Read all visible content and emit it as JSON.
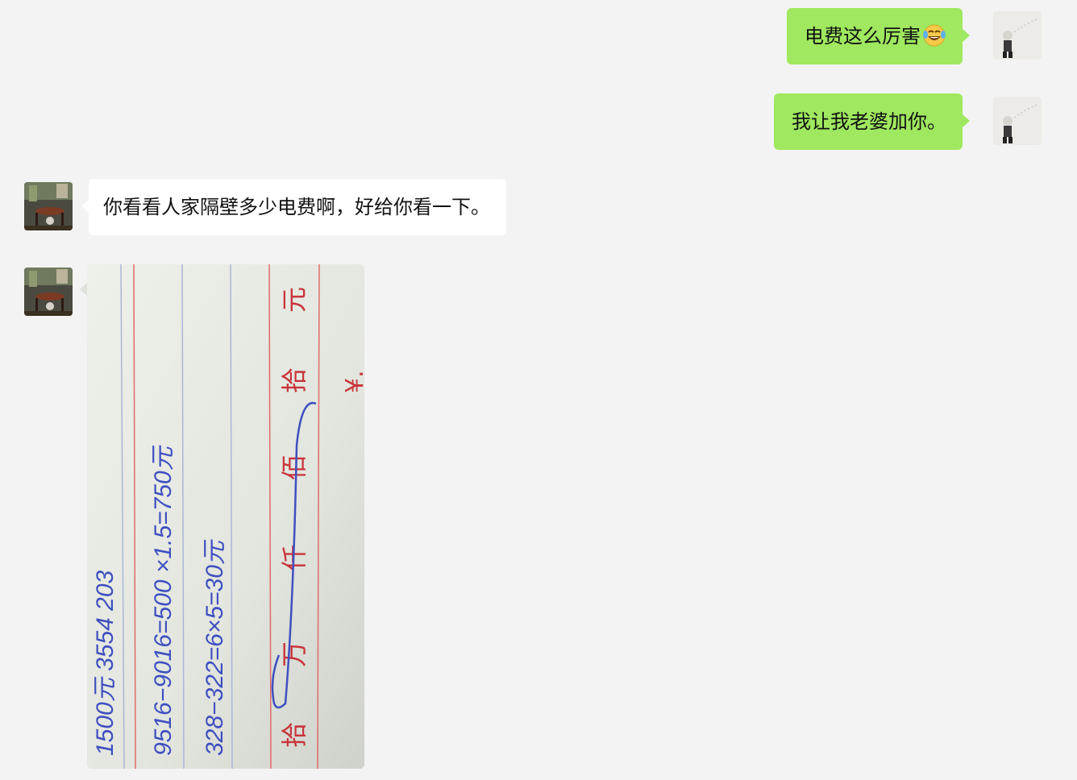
{
  "messages": [
    {
      "side": "out",
      "text": "电费这么厉害",
      "emoji": "tears-of-joy-emoji"
    },
    {
      "side": "out",
      "text": "我让我老婆加你。"
    },
    {
      "side": "in",
      "text": "你看看人家隔壁多少电费啊，好给你看一下。"
    },
    {
      "side": "in",
      "type": "image"
    }
  ],
  "receipt": {
    "line1": "1500元 3554 203",
    "line2": "9516−9016=500 ×1.5=750元",
    "line3": "328−322=6×5=30元",
    "amount_header": [
      "拾",
      "万",
      "仟",
      "佰",
      "拾",
      "元"
    ],
    "currency_mark": "¥.",
    "colors": {
      "paper": "#e8eae4",
      "rule_red": "#e06a6a",
      "rule_blue": "#a9b7d6",
      "ink_blue": "#3e4fc0",
      "ink_red": "#c8343a"
    }
  },
  "colors": {
    "background": "#f3f3f3",
    "outgoing_bubble": "#9fe85f",
    "incoming_bubble": "#ffffff"
  }
}
